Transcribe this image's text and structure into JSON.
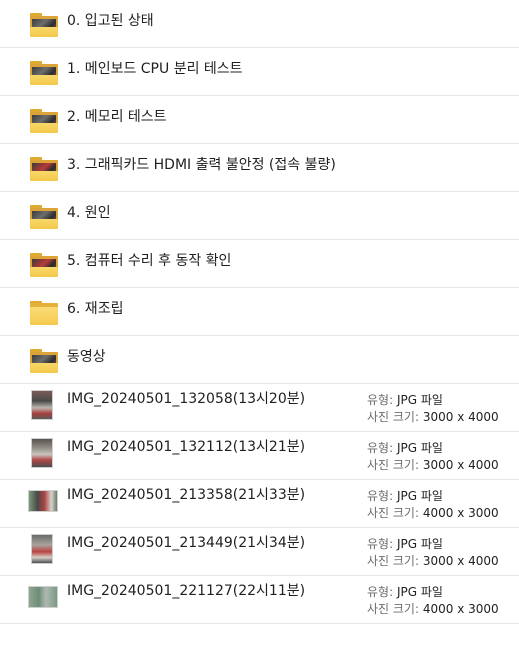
{
  "folders": [
    {
      "label": "0. 입고된 상태",
      "thumb": "dark"
    },
    {
      "label": "1. 메인보드 CPU 분리 테스트",
      "thumb": "dark"
    },
    {
      "label": "2. 메모리 테스트",
      "thumb": "dark"
    },
    {
      "label": "3. 그래픽카드 HDMI 출력 불안정 (접속 불량)",
      "thumb": "red"
    },
    {
      "label": "4. 원인",
      "thumb": "dark"
    },
    {
      "label": "5. 컴퓨터 수리 후 동작 확인",
      "thumb": "red"
    },
    {
      "label": "6. 재조립",
      "thumb": "none"
    },
    {
      "label": "동영상",
      "thumb": "dark-partial"
    }
  ],
  "photos": [
    {
      "name": "IMG_20240501_132058(13시20분)",
      "type_key": "유형:",
      "type_val": "JPG 파일",
      "size_key": "사진 크기:",
      "size_val": "3000 x 4000",
      "orientation": "portrait",
      "tone": "red-grey"
    },
    {
      "name": "IMG_20240501_132112(13시21분)",
      "type_key": "유형:",
      "type_val": "JPG 파일",
      "size_key": "사진 크기:",
      "size_val": "3000 x 4000",
      "orientation": "portrait",
      "tone": "grey-red"
    },
    {
      "name": "IMG_20240501_213358(21시33분)",
      "type_key": "유형:",
      "type_val": "JPG 파일",
      "size_key": "사진 크기:",
      "size_val": "4000 x 3000",
      "orientation": "landscape",
      "tone": "green-red"
    },
    {
      "name": "IMG_20240501_213449(21시34분)",
      "type_key": "유형:",
      "type_val": "JPG 파일",
      "size_key": "사진 크기:",
      "size_val": "3000 x 4000",
      "orientation": "portrait",
      "tone": "grey-red"
    },
    {
      "name": "IMG_20240501_221127(22시11분)",
      "type_key": "유형:",
      "type_val": "JPG 파일",
      "size_key": "사진 크기:",
      "size_val": "4000 x 3000",
      "orientation": "landscape",
      "tone": "green"
    }
  ],
  "colors": {
    "folder_yellow": "#f5c94d",
    "folder_dark": "#dca437",
    "divider": "#e5e5e5",
    "meta_label": "#6d6d6d"
  }
}
